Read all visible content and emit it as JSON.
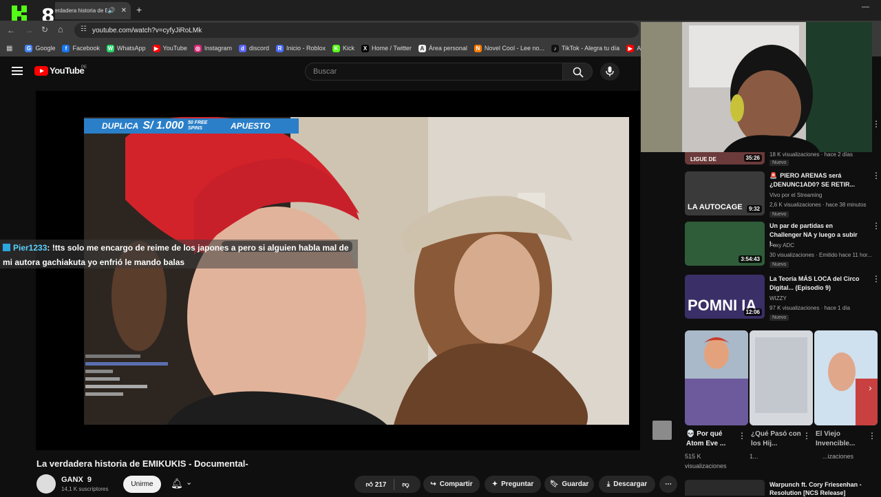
{
  "browser": {
    "tab_title": "La verdadera historia de EM",
    "url": "youtube.com/watch?v=cyfyJiRoLMk",
    "overlay_number": "8",
    "bookmarks": [
      {
        "label": "Google",
        "color": "#4285f4",
        "glyph": "G"
      },
      {
        "label": "Facebook",
        "color": "#1877f2",
        "glyph": "f"
      },
      {
        "label": "WhatsApp",
        "color": "#25d366",
        "glyph": "W"
      },
      {
        "label": "YouTube",
        "color": "#ff0000",
        "glyph": "▶"
      },
      {
        "label": "Instagram",
        "color": "#d62976",
        "glyph": "◎"
      },
      {
        "label": "discord",
        "color": "#5865f2",
        "glyph": "d"
      },
      {
        "label": "Inicio - Roblox",
        "color": "#4a6cf7",
        "glyph": "R"
      },
      {
        "label": "Kick",
        "color": "#53fc18",
        "glyph": "K"
      },
      {
        "label": "Home / Twitter",
        "color": "#000000",
        "glyph": "X"
      },
      {
        "label": "Área personal",
        "color": "#eeeeee",
        "glyph": "A"
      },
      {
        "label": "Novel Cool - Lee no...",
        "color": "#ff7a00",
        "glyph": "N"
      },
      {
        "label": "TikTok - Alegra tu día",
        "color": "#111111",
        "glyph": "♪"
      },
      {
        "label": "Acad",
        "color": "#ff0000",
        "glyph": "▶"
      }
    ]
  },
  "youtube": {
    "logo": "YouTube",
    "country": "PE",
    "search_placeholder": "Buscar"
  },
  "video": {
    "banner_prefix": "DUPLICA",
    "banner_amount": "S/ 1.000",
    "banner_spins": "50 FREE SPINS",
    "banner_brand": "APUESTO",
    "chat_user": "Pier1233",
    "chat_text": ": !tts solo me encargo de reime de los japones a pero si alguien habla mal de mi autora gachiakuta yo enfrió le mando balas",
    "title": "La verdadera historia de EMIKUKIS - Documental-",
    "channel": "GANX",
    "channel_suffix": "9",
    "subscribers": "14,1 K suscriptores",
    "join_label": "Unirme",
    "likes": "217",
    "share_label": "Compartir",
    "ask_label": "Preguntar",
    "save_label": "Guardar",
    "download_label": "Descargar"
  },
  "sidebar": {
    "partial": {
      "meta": "18 K visualizaciones · hace 2 días",
      "badge": "Nuevo",
      "duration": "35:26",
      "thumb_text": "LIGUE DE"
    },
    "items": [
      {
        "title": "PIERO ARENAS será ¿DENUNC1AD0? SE RETIR...",
        "channel": "Vivo por el Streaming",
        "meta": "2,6 K visualizaciones · hace 38 minutos",
        "badge": "Nuevo",
        "duration": "9:32",
        "thumb_text": "LA AUTOCAGE",
        "title_prefix": "🚨"
      },
      {
        "title": "Un par de partidas en Challenger NA y luego a subir l...",
        "channel": "Foxy ADC",
        "meta": "30 visualizaciones · Emitido hace 11 hor...",
        "badge": "Nuevo",
        "duration": "3:54:43",
        "thumb_text": ""
      },
      {
        "title": "La Teoría MÁS LOCA del Circo Digital... (Episodio 9)",
        "channel": "WIZZY",
        "meta": "97 K visualizaciones · hace 1 día",
        "badge": "Nuevo",
        "duration": "12:06",
        "thumb_text": "POMNI IA"
      }
    ],
    "shorts": [
      {
        "title": "💀 Por qué Atom Eve ...",
        "views": "515 K visualizaciones"
      },
      {
        "title": "¿Qué Pasó con los Hij...",
        "views": "1..."
      },
      {
        "title": "El Viejo Invencible...",
        "views": "...izaciones"
      }
    ],
    "bottom": {
      "title": "Warpunch ft. Cory Friesenhan - Resolution [NCS Release]"
    }
  },
  "colors": {
    "page_bg": "#0f0f0f",
    "brand_red": "#ff0000",
    "chat_user": "#5ad3ff",
    "kick_green": "#53fc18"
  }
}
